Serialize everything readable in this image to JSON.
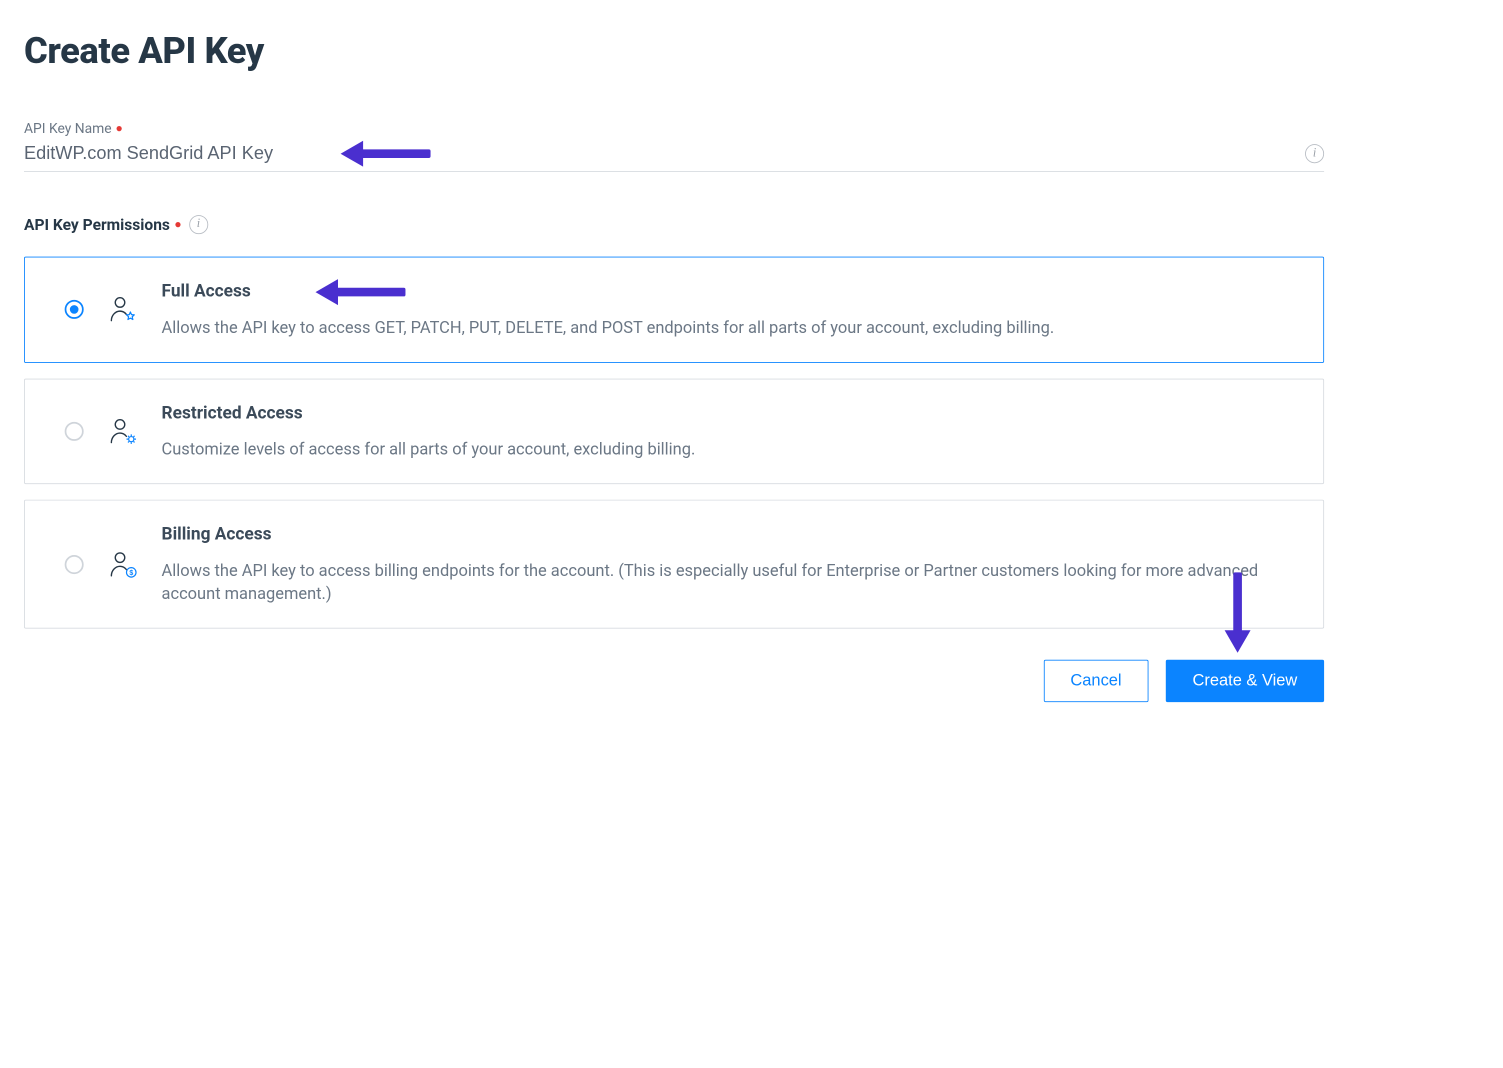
{
  "page": {
    "title": "Create API Key"
  },
  "name_field": {
    "label": "API Key Name",
    "value": "EditWP.com SendGrid API Key"
  },
  "permissions": {
    "heading": "API Key Permissions",
    "options": [
      {
        "id": "full",
        "title": "Full Access",
        "desc": "Allows the API key to access GET, PATCH, PUT, DELETE, and POST endpoints for all parts of your account, excluding billing.",
        "selected": true,
        "icon": "user-star-icon"
      },
      {
        "id": "restricted",
        "title": "Restricted Access",
        "desc": "Customize levels of access for all parts of your account, excluding billing.",
        "selected": false,
        "icon": "user-gear-icon"
      },
      {
        "id": "billing",
        "title": "Billing Access",
        "desc": "Allows the API key to access billing endpoints for the account. (This is especially useful for Enterprise or Partner customers looking for more advanced account management.)",
        "selected": false,
        "icon": "user-dollar-icon"
      }
    ]
  },
  "actions": {
    "cancel": "Cancel",
    "create": "Create & View"
  }
}
